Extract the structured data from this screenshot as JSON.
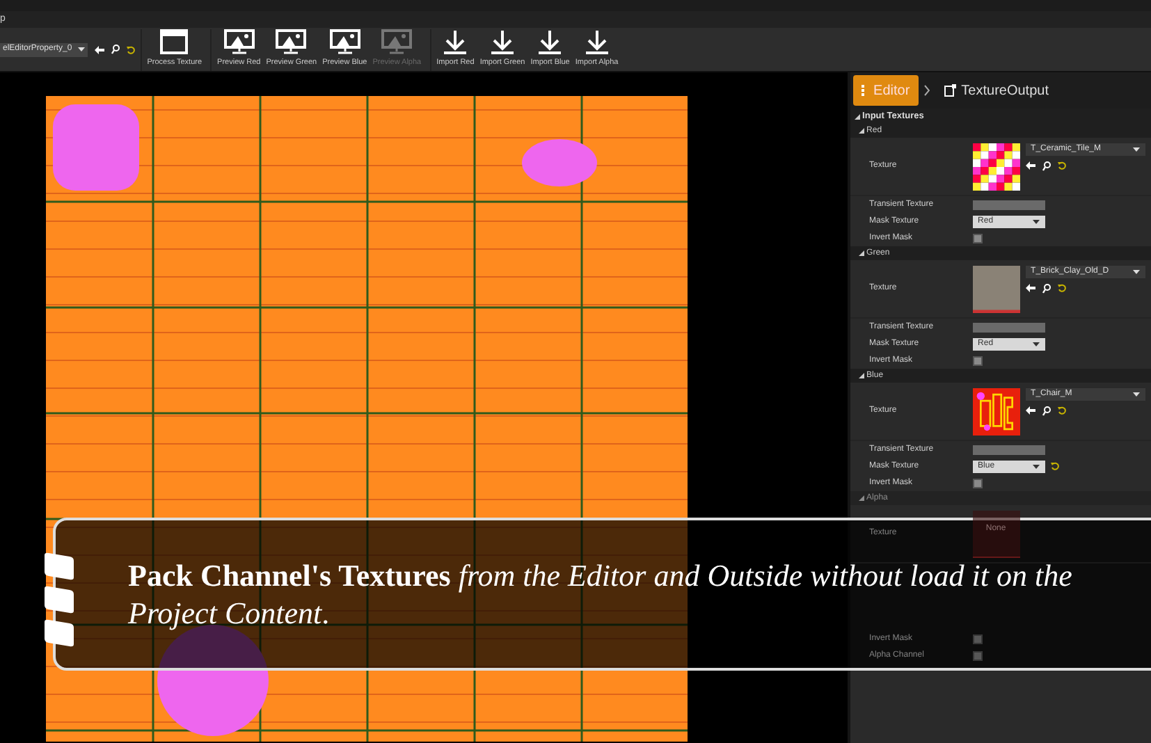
{
  "menu_bar": {
    "item": "p"
  },
  "toolbar": {
    "asset_dropdown": "elEditorProperty_0",
    "groups": [
      [
        {
          "label": "Process Texture",
          "kind": "process",
          "disabled": false
        }
      ],
      [
        {
          "label": "Preview Red",
          "kind": "preview",
          "disabled": false
        },
        {
          "label": "Preview Green",
          "kind": "preview",
          "disabled": false
        },
        {
          "label": "Preview Blue",
          "kind": "preview",
          "disabled": false
        },
        {
          "label": "Preview Alpha",
          "kind": "preview",
          "disabled": true
        }
      ],
      [
        {
          "label": "Import Red",
          "kind": "import",
          "disabled": false
        },
        {
          "label": "Import Green",
          "kind": "import",
          "disabled": false
        },
        {
          "label": "Import Blue",
          "kind": "import",
          "disabled": false
        },
        {
          "label": "Import Alpha",
          "kind": "import",
          "disabled": false
        }
      ]
    ]
  },
  "breadcrumb": [
    {
      "label": "Editor",
      "selected": true
    },
    {
      "label": "TextureOutput",
      "selected": false
    }
  ],
  "details": {
    "category": "Input Textures",
    "sections": [
      {
        "name": "Red",
        "rows": [
          {
            "kind": "texture_checker",
            "label": "Texture",
            "value": "T_Ceramic_Tile_M"
          },
          {
            "kind": "field",
            "label": "Transient Texture"
          },
          {
            "kind": "dropdown",
            "label": "Mask Texture",
            "value": "Red"
          },
          {
            "kind": "checkbox",
            "label": "Invert Mask",
            "checked": false
          }
        ]
      },
      {
        "name": "Green",
        "rows": [
          {
            "kind": "texture_brick",
            "label": "Texture",
            "value": "T_Brick_Clay_Old_D"
          },
          {
            "kind": "field",
            "label": "Transient Texture"
          },
          {
            "kind": "dropdown",
            "label": "Mask Texture",
            "value": "Red"
          },
          {
            "kind": "checkbox",
            "label": "Invert Mask",
            "checked": false
          }
        ]
      },
      {
        "name": "Blue",
        "rows": [
          {
            "kind": "texture_chair",
            "label": "Texture",
            "value": "T_Chair_M"
          },
          {
            "kind": "field",
            "label": "Transient Texture"
          },
          {
            "kind": "dropdown_reset",
            "label": "Mask Texture",
            "value": "Blue"
          },
          {
            "kind": "checkbox",
            "label": "Invert Mask",
            "checked": false
          }
        ]
      },
      {
        "name": "Alpha",
        "rows": [
          {
            "kind": "texture_none",
            "label": "Texture",
            "thumbnail_text": "None"
          },
          {
            "kind": "spacer"
          },
          {
            "kind": "checkbox",
            "label": "Invert Mask",
            "checked": false
          },
          {
            "kind": "checkbox",
            "label": "Alpha Channel",
            "checked": false
          }
        ]
      }
    ]
  },
  "caption": "**Pack Channel's Textures** *from the Editor and Outside without load it on the Project Content*."
}
